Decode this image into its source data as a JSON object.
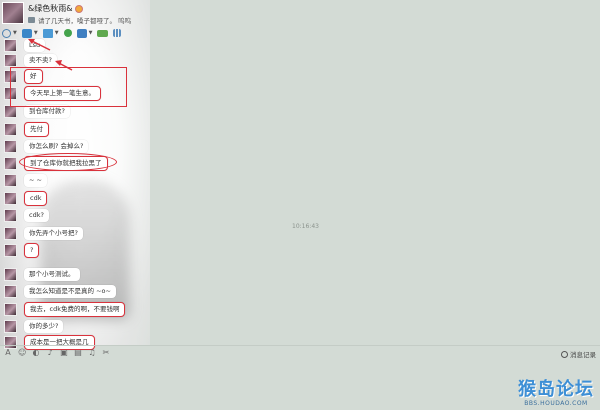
{
  "header": {
    "contact_name": "&绿色秋雨&",
    "status_text": "请了几天书，嗓子都哑了。 呜呜",
    "toolbar_icons": [
      "audio-call-icon",
      "video-call-icon",
      "file-transfer-icon",
      "remote-assist-icon",
      "screen-share-icon",
      "card-icon",
      "apps-grid-icon"
    ]
  },
  "messages": [
    {
      "text": "Lsu",
      "highlight": false
    },
    {
      "text": "卖不卖?",
      "highlight": false
    },
    {
      "text": "好",
      "highlight": true
    },
    {
      "text": "今天早上第一笔生意。",
      "highlight": true
    },
    {
      "text": "到仓库付款?",
      "highlight": false
    },
    {
      "text": "先付",
      "highlight": true
    },
    {
      "text": "你怎么刷? 会掉么?",
      "highlight": false
    },
    {
      "text": "到了仓库你就把我拉黑了",
      "highlight": true
    },
    {
      "text": "~ ~",
      "highlight": false
    },
    {
      "text": "cdk",
      "highlight": true
    },
    {
      "text": "cdk?",
      "highlight": false
    },
    {
      "text": "你先弄个小号把?",
      "highlight": false
    },
    {
      "text": "?",
      "highlight": true
    },
    {
      "text": "那个小号测试。",
      "highlight": false
    },
    {
      "text": "我怎么知道是不是真的 ~o~",
      "highlight": false
    },
    {
      "text": "我去，cdk免费的啊，不要钱啊",
      "highlight": true
    },
    {
      "text": "你的多少?",
      "highlight": false
    },
    {
      "text": "成本是一把大概是几",
      "highlight": true
    }
  ],
  "timestamp": "10:16:43",
  "input_toolbar_icons": [
    "font-icon",
    "emoji-icon",
    "shake-icon",
    "voice-icon",
    "image-icon",
    "gift-icon",
    "music-icon",
    "scissors-icon"
  ],
  "message_record_label": "消息记录",
  "watermark": {
    "title": "猴岛论坛",
    "url": "BBS.HOUDAO.COM"
  },
  "colors": {
    "background": "#d3dbd5",
    "highlight_red": "#d9323c",
    "bubble": "#ffffff",
    "watermark_blue": "#3d8fd6"
  }
}
